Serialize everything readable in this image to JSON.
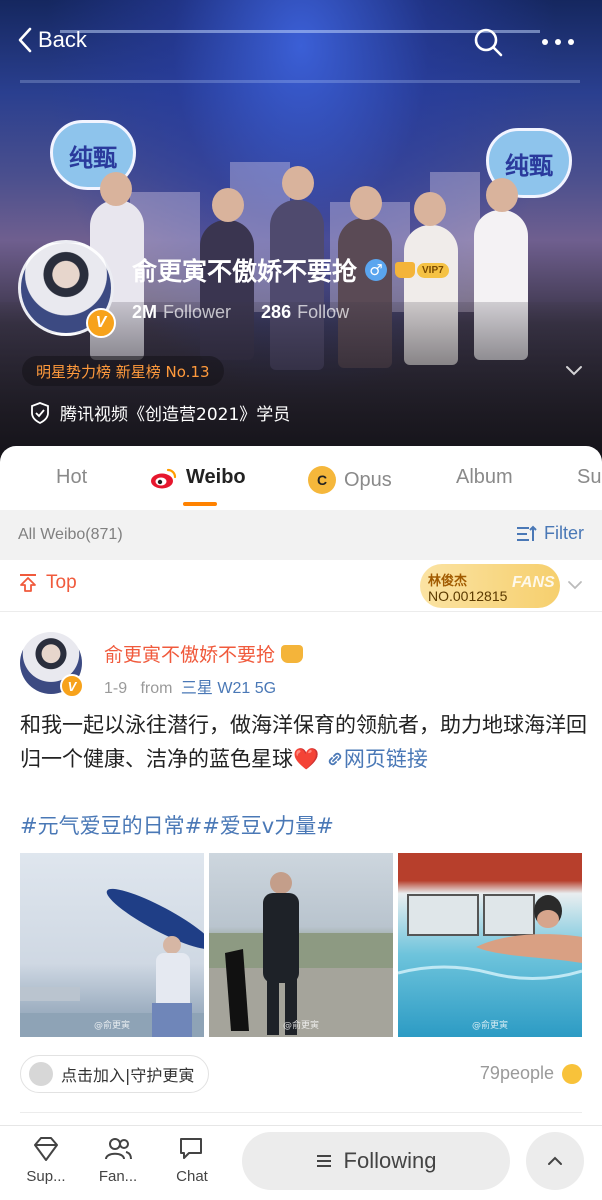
{
  "nav": {
    "back_label": "Back"
  },
  "banner": {
    "heart_left_text": "纯甄",
    "heart_right_text": "纯甄"
  },
  "profile": {
    "name": "俞更寅不傲娇不要抢",
    "gender_symbol": "♂",
    "vip_label": "VIP7",
    "verified_badge": "V",
    "followers_count": "2M",
    "followers_label": "Follower",
    "following_count": "286",
    "following_label": "Follow",
    "rank_text": "明星势力榜 新星榜 No.13",
    "certification": "腾讯视频《创造营2021》学员"
  },
  "tabs": [
    {
      "label": "Hot",
      "active": false
    },
    {
      "label": "Weibo",
      "active": true
    },
    {
      "label": "Opus",
      "active": false
    },
    {
      "label": "Album",
      "active": false
    },
    {
      "label": "Su",
      "active": false
    }
  ],
  "filter_bar": {
    "all_weibo": "All Weibo(871)",
    "filter_label": "Filter"
  },
  "post": {
    "top_label": "Top",
    "fans_badge": {
      "name": "林俊杰",
      "number": "NO.0012815",
      "fans": "FANS"
    },
    "author": "俞更寅不傲娇不要抢",
    "verified_badge": "V",
    "date": "1-9",
    "from_label": "from",
    "device": "三星 W21 5G",
    "text": "和我一起以泳往潜行，做海洋保育的领航者，助力地球海洋回归一个健康、洁净的蓝色星球",
    "heart": "❤️",
    "link_label": "网页链接",
    "hashtags": "#元气爱豆的日常##爱豆v力量#",
    "photos": [
      {
        "watermark": "@俞更寅"
      },
      {
        "watermark": "@俞更寅"
      },
      {
        "watermark": "@俞更寅"
      }
    ],
    "guard_label": "点击加入|守护更寅",
    "people_count": "79people"
  },
  "bottom_bar": {
    "items": [
      {
        "label": "Sup..."
      },
      {
        "label": "Fan..."
      },
      {
        "label": "Chat"
      }
    ],
    "following_label": "Following"
  },
  "colors": {
    "accent_orange": "#ff8200",
    "link_blue": "#4a78b6",
    "name_red": "#f05a3c",
    "rank_orange": "#ff9a3c"
  },
  "icons": [
    "back-icon",
    "search-icon",
    "more-icon",
    "gender-male-icon",
    "vip-crown-icon",
    "chevron-down-icon",
    "shield-icon",
    "weibo-icon",
    "opus-icon",
    "filter-icon",
    "pin-top-icon",
    "link-icon",
    "guard-icon",
    "emoji-icon",
    "diamond-icon",
    "fans-icon",
    "chat-icon",
    "list-icon",
    "chevron-up-icon"
  ]
}
